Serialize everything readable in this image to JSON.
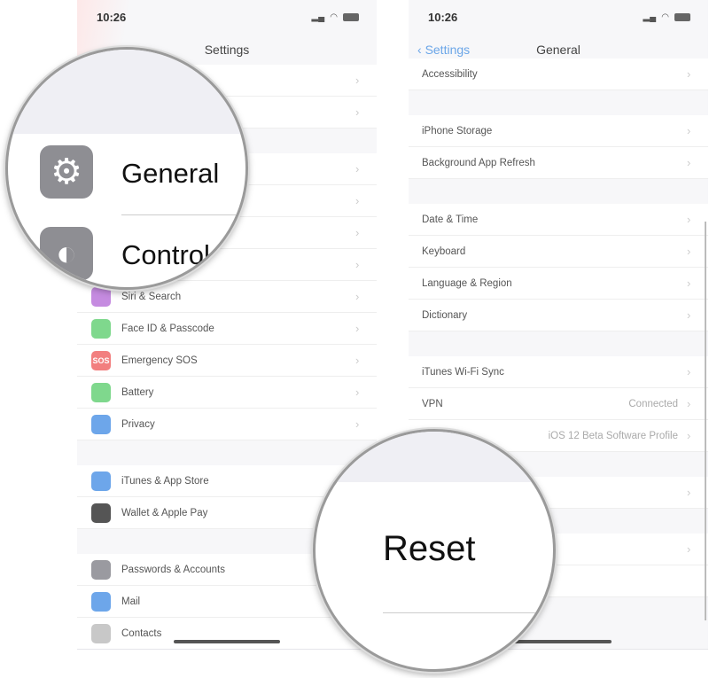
{
  "left": {
    "time": "10:26",
    "title": "Settings",
    "rows": [
      {
        "label": "Siri & Search",
        "icon": "siri-icon",
        "color": "#c58be0"
      },
      {
        "label": "Face ID & Passcode",
        "icon": "face-id-icon",
        "color": "#7fd88d"
      },
      {
        "label": "Emergency SOS",
        "icon": "sos-icon",
        "color": "#f27f7f",
        "glyph": "SOS"
      },
      {
        "label": "Battery",
        "icon": "battery-icon",
        "color": "#7fd88d"
      },
      {
        "label": "Privacy",
        "icon": "hand-icon",
        "color": "#6da6ea"
      },
      {
        "label": "iTunes & App Store",
        "icon": "app-store-icon",
        "color": "#6da6ea"
      },
      {
        "label": "Wallet & Apple Pay",
        "icon": "wallet-icon",
        "color": "#555555"
      },
      {
        "label": "Passwords & Accounts",
        "icon": "key-icon",
        "color": "#9a9aa0"
      },
      {
        "label": "Mail",
        "icon": "mail-icon",
        "color": "#6da6ea"
      },
      {
        "label": "Contacts",
        "icon": "contacts-icon",
        "color": "#c8c8c8"
      }
    ],
    "magnifier": {
      "item1": "General",
      "item2": "Control"
    }
  },
  "right": {
    "time": "10:26",
    "back": "Settings",
    "title": "General",
    "rows": [
      "Accessibility",
      "iPhone Storage",
      "Background App Refresh",
      "Date & Time",
      "Keyboard",
      "Language & Region",
      "Dictionary",
      "iTunes Wi-Fi Sync",
      "VPN",
      ""
    ],
    "vpn_value": "Connected",
    "profile_value": "iOS 12 Beta Software Profile",
    "magnifier": {
      "item": "Reset"
    }
  },
  "colors": {
    "accent": "#6ba6e8"
  }
}
